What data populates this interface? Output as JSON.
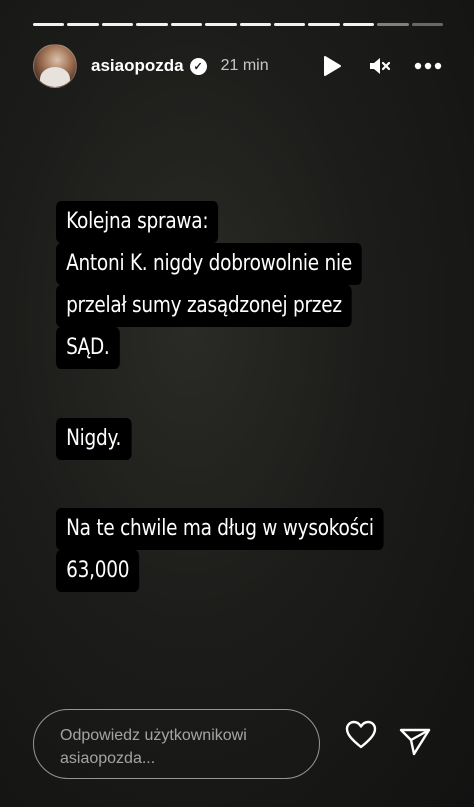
{
  "story": {
    "progress_segments": 12,
    "progress_done": 10,
    "username": "asiaopozda",
    "timestamp": "21 min",
    "verified": true
  },
  "icons": {
    "play": "play-icon",
    "mute": "muted-speaker-icon",
    "more": "more-options-icon",
    "like": "heart-icon",
    "share": "send-icon"
  },
  "text_blocks": [
    {
      "lines": [
        "Kolejna sprawa:",
        "Antoni K. nigdy dobrowolnie nie",
        "przelał sumy zasądzonej przez",
        "SĄD."
      ]
    },
    {
      "lines": [
        "Nigdy."
      ]
    },
    {
      "lines": [
        "Na te chwile ma dług w wysokości",
        "63,000"
      ]
    }
  ],
  "reply": {
    "placeholder_line1": "Odpowiedz użytkownikowi",
    "placeholder_line2": "asiaopozda..."
  }
}
